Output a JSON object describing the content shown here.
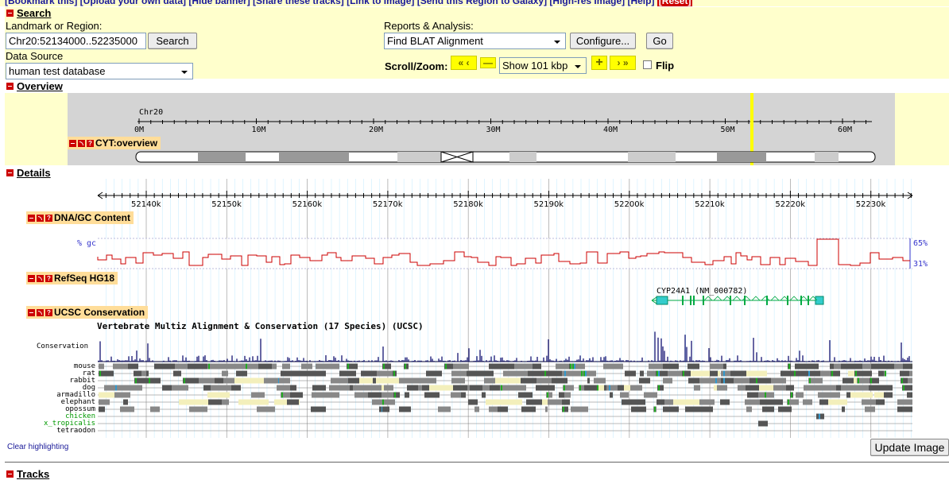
{
  "top_links": {
    "text": "[Bookmark this] [Upload your own data] [Hide banner] [Share these tracks] [Link to Image] [Send this Region to Galaxy] [High-res Image] [Help]",
    "reset": "[Reset]"
  },
  "search": {
    "header": "Search",
    "landmark_label": "Landmark or Region:",
    "landmark_value": "Chr20:52134000..52235000",
    "search_button": "Search",
    "data_source_label": "Data Source",
    "data_source_value": "human test database",
    "reports_label": "Reports & Analysis:",
    "reports_value": "Find BLAT Alignment",
    "configure_button": "Configure...",
    "go_button": "Go",
    "scroll_zoom_label": "Scroll/Zoom:",
    "zoom_value": "Show 101 kbp",
    "flip_label": "Flip",
    "flip_checked": false
  },
  "overview": {
    "header": "Overview",
    "chrom_label": "Chr20",
    "ticks": [
      "0M",
      "10M",
      "20M",
      "30M",
      "40M",
      "50M",
      "60M"
    ],
    "track_name": "CYT:overview",
    "highlight_color": "#ffff00"
  },
  "details": {
    "header": "Details",
    "ticks": [
      "52140k",
      "52150k",
      "52160k",
      "52170k",
      "52180k",
      "52190k",
      "52200k",
      "52210k",
      "52220k",
      "52230k"
    ],
    "tracks": {
      "gc": {
        "name": "DNA/GC Content",
        "ylabel": "% gc",
        "max_label": "65%",
        "min_label": "31%",
        "line_color": "#cc0000"
      },
      "refseq": {
        "name": "RefSeq HG18",
        "gene_label": "CYP24A1 (NM_000782)",
        "gene_color": "#00aa44",
        "exon_color": "#33cccc"
      },
      "conservation": {
        "name": "UCSC Conservation",
        "title": "Vertebrate Multiz Alignment & Conservation (17 Species) (UCSC)",
        "cons_label": "Conservation",
        "species": [
          "mouse",
          "rat",
          "rabbit",
          "dog",
          "armadillo",
          "elephant",
          "opossum",
          "chicken",
          "x_tropicalis",
          "tetraodon"
        ],
        "species_colors": [
          "#000000",
          "#000000",
          "#000000",
          "#000000",
          "#000000",
          "#000000",
          "#000000",
          "#009900",
          "#009900",
          "#000000"
        ]
      }
    },
    "clear_highlighting": "Clear highlighting",
    "update_image": "Update Image"
  },
  "tracks_section": {
    "header": "Tracks"
  }
}
